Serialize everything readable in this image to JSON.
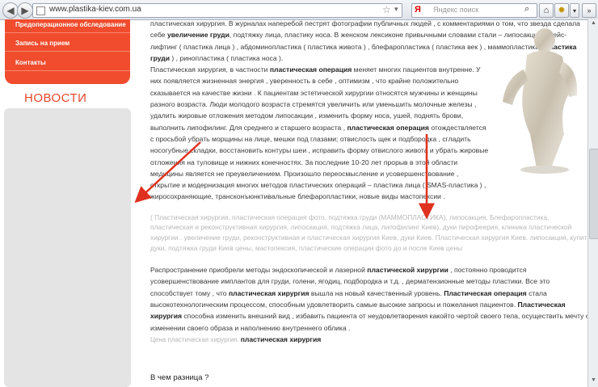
{
  "browser": {
    "url": "www.plastika-kiev.com.ua",
    "search_placeholder": "Яндекс поиск",
    "search_engine_letter": "Я",
    "back_glyph": "◀",
    "forward_glyph": "▶"
  },
  "sidebar": {
    "menu_items": [
      {
        "label": "Предоперационное обследование"
      },
      {
        "label": "Запись на прием"
      },
      {
        "label": "Контакты"
      }
    ],
    "news_title": "НОВОСТИ",
    "accent_color": "#f04c2d"
  },
  "content": {
    "p1": [
      {
        "t": "пластическая хирургия. В журналах наперебой пестрят фотографии публичных людей , с комментариями о том, что звезда сделала себе "
      },
      {
        "t": "увеличение груди",
        "b": true
      },
      {
        "t": ", подтяжку лица, пластику носа. В женском лексиконе привычными словами стали – липосакция , фейс-лифтинг ( пластика лица ) , абдоминопластика ( пластика живота ) , блефаропластика ( пластика век ) , маммопластика ( "
      },
      {
        "t": "пластика груди",
        "b": true
      },
      {
        "t": " ) , ринопластика ( пластика носа )."
      }
    ],
    "p2": [
      {
        "t": "Пластическая хирургия, в частности "
      },
      {
        "t": "пластическая операция",
        "b": true
      },
      {
        "t": " меняет многих пациентов внутренне. У них появляется жизненная энергия , уверенность в себе , оптимизм , что крайне положительно сказывается на качестве жизни . К пациентам эстетической хирургии относятся мужчины и женщины разного возраста. Люди молодого возраста стремятся увеличить или уменьшить молочные железы , удалить жировые отложения методом липосакции , изменить форму носа, ушей, поднять брови, выполнить липофилинг. Для среднего и старшего возраста , "
      },
      {
        "t": "пластическая операция",
        "b": true
      },
      {
        "t": " отождествляется с просьбой убрать морщины на лице, мешки под глазами; отвислость щек и подбородка , сгладить носогубные складки, восстановить контуры шеи , исправить форму отвислого живота и убрать жировые отложения на туловище и нижних конечностях. За последние 10-20 лет прорыв в этой области медицины является не преувеличением. Произошло переосмысление и усовершенствование , открытие и модернизация многих методов пластических операций – пластика лица ( SMAS-пластика ) , жиросохраняющие, трансконъюнктивальные блефаропластики, новые виды мастопексии ."
      }
    ],
    "tags": "( Пластическая хирургия, пластическая операция фото, подтяжка груди (МАММОПЛАСТИКА), липосакция, Блефаропластика, пластическая и реконструктивная хирургия, липосакция, подтяжка лица, липофилинг Киев), дуки пирофеерия, клиника пластической хирургии . увеличение груди, реконструктивная и пластическая хирургия Киев, дуки Киев. Пластическая хирургия Киев. липосакция, купить дуки, подтяжка груди Киев цены, мастопексия, пластические операции фото до и после Киев цены",
    "p3": [
      {
        "t": "Распространение приобрели методы эндоскопической и лазерной "
      },
      {
        "t": "пластической хирургии",
        "b": true
      },
      {
        "t": " , постоянно проводится усовершенствование имплантов для груди, голени, ягодиц, подбородка и т.д. , дерматензионные методы пластики. Все это способствует тому , что "
      },
      {
        "t": "пластическая хирургия",
        "b": true
      },
      {
        "t": " вышла на новый качественный уровень. "
      },
      {
        "t": "Пластическая операция",
        "b": true
      },
      {
        "t": " стала высокотехнологическим процессом, способным удовлетворить самые высокие запросы и пожелания пациентов. "
      },
      {
        "t": "Пластическая хирургия",
        "b": true
      },
      {
        "t": " способна изменить внешний вид , избавить пациента от неудовлетворения какойто чертой своего тела, осуществить мечту о изменении своего образа и наполнению внутреннего облика ."
      }
    ],
    "price_line": [
      {
        "t": "Цена ",
        "d": true
      },
      {
        "t": "пластическая хирургия. ",
        "d": true
      },
      {
        "t": "пластическая хирургия",
        "b": true
      }
    ],
    "heading": "В чем разница ?"
  },
  "annotation_color": "#e0301e"
}
